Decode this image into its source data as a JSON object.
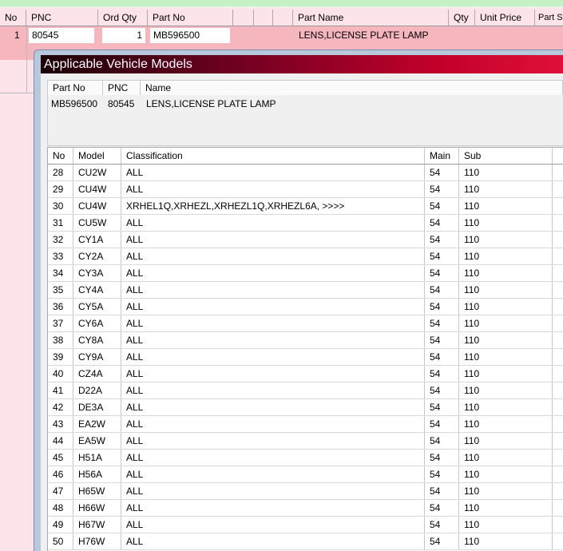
{
  "main_table": {
    "headers": [
      "No",
      "PNC",
      "Ord Qty",
      "Part No",
      "",
      "",
      "",
      "Part Name",
      "Qty",
      "Unit Price",
      "Part S"
    ],
    "row": {
      "no": "1",
      "pnc": "80545",
      "ord_qty": "1",
      "part_no": "MB596500",
      "part_name": "LENS,LICENSE PLATE LAMP"
    }
  },
  "dialog": {
    "title": "Applicable Vehicle Models",
    "info": {
      "headers": [
        "Part No",
        "PNC",
        "Name"
      ],
      "values": [
        "MB596500",
        "80545",
        "LENS,LICENSE PLATE LAMP"
      ]
    },
    "grid": {
      "headers": [
        "No",
        "Model",
        "Classification",
        "Main",
        "Sub"
      ],
      "rows": [
        [
          "28",
          "CU2W",
          "ALL",
          "54",
          "110"
        ],
        [
          "29",
          "CU4W",
          "ALL",
          "54",
          "110"
        ],
        [
          "30",
          "CU4W",
          "XRHEL1Q,XRHEZL,XRHEZL1Q,XRHEZL6A,  >>>>",
          "54",
          "110"
        ],
        [
          "31",
          "CU5W",
          "ALL",
          "54",
          "110"
        ],
        [
          "32",
          "CY1A",
          "ALL",
          "54",
          "110"
        ],
        [
          "33",
          "CY2A",
          "ALL",
          "54",
          "110"
        ],
        [
          "34",
          "CY3A",
          "ALL",
          "54",
          "110"
        ],
        [
          "35",
          "CY4A",
          "ALL",
          "54",
          "110"
        ],
        [
          "36",
          "CY5A",
          "ALL",
          "54",
          "110"
        ],
        [
          "37",
          "CY6A",
          "ALL",
          "54",
          "110"
        ],
        [
          "38",
          "CY8A",
          "ALL",
          "54",
          "110"
        ],
        [
          "39",
          "CY9A",
          "ALL",
          "54",
          "110"
        ],
        [
          "40",
          "CZ4A",
          "ALL",
          "54",
          "110"
        ],
        [
          "41",
          "D22A",
          "ALL",
          "54",
          "110"
        ],
        [
          "42",
          "DE3A",
          "ALL",
          "54",
          "110"
        ],
        [
          "43",
          "EA2W",
          "ALL",
          "54",
          "110"
        ],
        [
          "44",
          "EA5W",
          "ALL",
          "54",
          "110"
        ],
        [
          "45",
          "H51A",
          "ALL",
          "54",
          "110"
        ],
        [
          "46",
          "H56A",
          "ALL",
          "54",
          "110"
        ],
        [
          "47",
          "H65W",
          "ALL",
          "54",
          "110"
        ],
        [
          "48",
          "H66W",
          "ALL",
          "54",
          "110"
        ],
        [
          "49",
          "H67W",
          "ALL",
          "54",
          "110"
        ],
        [
          "50",
          "H76W",
          "ALL",
          "54",
          "110"
        ]
      ]
    }
  }
}
